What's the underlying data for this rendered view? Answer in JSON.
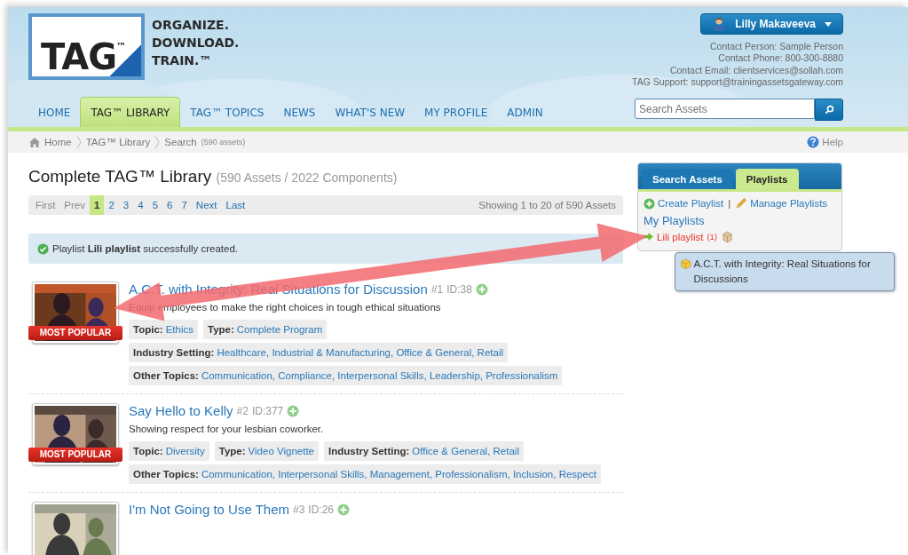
{
  "header": {
    "logo": "TAG$^{™}$",
    "tagline": [
      "ORGANIZE.",
      "DOWNLOAD.",
      "TRAIN.™"
    ],
    "user": "Lilly Makaveeva",
    "contacts": [
      "Contact Person: Sample Person",
      "Contact Phone: 800-300-8880",
      "Contact Email: clientservices@sollah.com",
      "TAG Support: support@trainingassetsgateway.com"
    ],
    "search": {
      "placeholder": "Search Assets"
    },
    "nav": [
      {
        "label": "HOME",
        "selected": false
      },
      {
        "label": "TAG™ LIBRARY",
        "selected": true
      },
      {
        "label": "TAG™ TOPICS",
        "selected": false
      },
      {
        "label": "NEWS",
        "selected": false
      },
      {
        "label": "WHAT'S NEW",
        "selected": false
      },
      {
        "label": "MY PROFILE",
        "selected": false
      },
      {
        "label": "ADMIN",
        "selected": false
      }
    ]
  },
  "breadcrumb": {
    "items": [
      "Home",
      "TAG™ Library",
      "Search"
    ],
    "count": "(590 assets)",
    "help": "Help"
  },
  "main": {
    "title": "Complete TAG™ Library",
    "subtitle": "(590 Assets / 2022 Components)",
    "pagination": {
      "pages": [
        {
          "label": "First",
          "selected": false,
          "disabled": true
        },
        {
          "label": "Prev",
          "selected": false,
          "disabled": true
        },
        {
          "label": "1",
          "selected": true,
          "disabled": false
        },
        {
          "label": "2",
          "selected": false,
          "disabled": false
        },
        {
          "label": "3",
          "selected": false,
          "disabled": false
        },
        {
          "label": "4",
          "selected": false,
          "disabled": false
        },
        {
          "label": "5",
          "selected": false,
          "disabled": false
        },
        {
          "label": "6",
          "selected": false,
          "disabled": false
        },
        {
          "label": "7",
          "selected": false,
          "disabled": false
        },
        {
          "label": "Next",
          "selected": false,
          "disabled": false
        },
        {
          "label": "Last",
          "selected": false,
          "disabled": false
        }
      ],
      "showing": "Showing 1 to 20 of 590 Assets"
    },
    "alert": "Playlist **Lili playlist** successfully created.",
    "assets": [
      {
        "title": "A.C.T. with Integrity: Real Situations for Discussion",
        "number": "#1",
        "id": "ID:38",
        "badge": "MOST POPULAR",
        "description": "Equip employees to make the right choices in tough ethical situations",
        "tag_rows": [
          [
            {
              "label": "Topic:",
              "values": [
                "Ethics"
              ]
            },
            {
              "label": "Type:",
              "values": [
                "Complete Program"
              ]
            }
          ],
          [
            {
              "label": "Industry Setting:",
              "values": [
                "Healthcare,",
                "Industrial & Manufacturing,",
                "Office & General,",
                "Retail"
              ]
            }
          ],
          [
            {
              "label": "Other Topics:",
              "values": [
                "Communication,",
                "Compliance,",
                "Interpersonal Skills,",
                "Leadership,",
                "Professionalism"
              ]
            }
          ]
        ]
      },
      {
        "title": "Say Hello to Kelly",
        "number": "#2",
        "id": "ID:377",
        "badge": "MOST POPULAR",
        "description": "Showing respect for your lesbian coworker.",
        "tag_rows": [
          [
            {
              "label": "Topic:",
              "values": [
                "Diversity"
              ]
            },
            {
              "label": "Type:",
              "values": [
                "Video Vignette"
              ]
            },
            {
              "label": "Industry Setting:",
              "values": [
                "Office & General,",
                "Retail"
              ]
            }
          ],
          [
            {
              "label": "Other Topics:",
              "values": [
                "Communication,",
                "Interpersonal Skills,",
                "Management,",
                "Professionalism,",
                "Inclusion,",
                "Respect"
              ]
            }
          ]
        ]
      },
      {
        "title": "I'm Not Going to Use Them",
        "number": "#3",
        "id": "ID:26"
      }
    ]
  },
  "sidebar": {
    "tabs": [
      {
        "label": "Search Assets",
        "selected": false
      },
      {
        "label": "Playlists",
        "selected": true
      }
    ],
    "create": "Create Playlist",
    "separator": "|",
    "manage": "Manage Playlists",
    "heading": "My Playlists",
    "playlist": {
      "name": "Lili playlist",
      "count": "(1)"
    },
    "tooltip": "A.C.T. with Integrity: Real Situations for Discussions"
  }
}
